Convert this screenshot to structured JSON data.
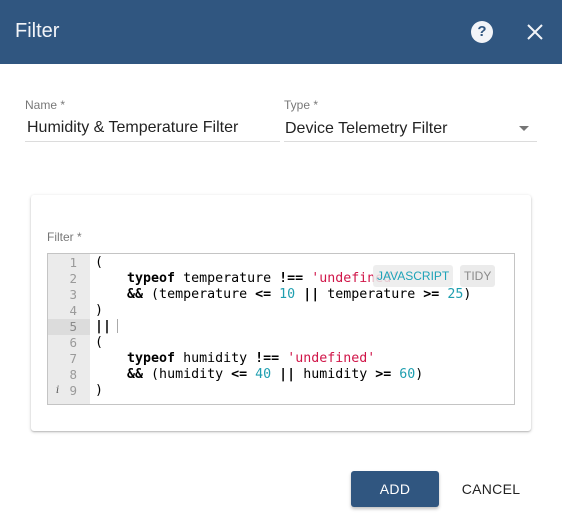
{
  "dialog": {
    "title": "Filter",
    "help_icon": "help-circle-icon",
    "close_icon": "close-icon"
  },
  "form": {
    "name": {
      "label": "Name *",
      "value": "Humidity & Temperature Filter"
    },
    "type": {
      "label": "Type *",
      "value": "Device Telemetry Filter",
      "icon": "dropdown-arrow-icon"
    },
    "filter": {
      "label": "Filter *"
    }
  },
  "editor": {
    "language_label": "JAVASCRIPT",
    "tidy_label": "TIDY",
    "info_marker": "i",
    "active_line": 5,
    "lines": [
      {
        "n": "1"
      },
      {
        "n": "2"
      },
      {
        "n": "3"
      },
      {
        "n": "4"
      },
      {
        "n": "5"
      },
      {
        "n": "6"
      },
      {
        "n": "7"
      },
      {
        "n": "8"
      },
      {
        "n": "9"
      }
    ],
    "code": {
      "l1": "(",
      "l2_kw": "typeof",
      "l2_id": " temperature ",
      "l2_op": "!==",
      "l2_str": "'undefined'",
      "l3_op1": "&&",
      "l3_a": " (temperature ",
      "l3_op2": "<=",
      "l3_n1": "10",
      "l3_op3": "||",
      "l3_b": " temperature ",
      "l3_op4": ">=",
      "l3_n2": "25",
      "l3_c": ")",
      "l4": ")",
      "l5": "||",
      "l6": "(",
      "l7_kw": "typeof",
      "l7_id": " humidity ",
      "l7_op": "!==",
      "l7_str": "'undefined'",
      "l8_op1": "&&",
      "l8_a": " (humidity ",
      "l8_op2": "<=",
      "l8_n1": "40",
      "l8_op3": "||",
      "l8_b": " humidity ",
      "l8_op4": ">=",
      "l8_n2": "60",
      "l8_c": ")",
      "l9": ")"
    }
  },
  "actions": {
    "add_label": "ADD",
    "cancel_label": "CANCEL"
  },
  "colors": {
    "primary": "#305680",
    "string": "#d01548",
    "number": "#1f9fb0"
  }
}
